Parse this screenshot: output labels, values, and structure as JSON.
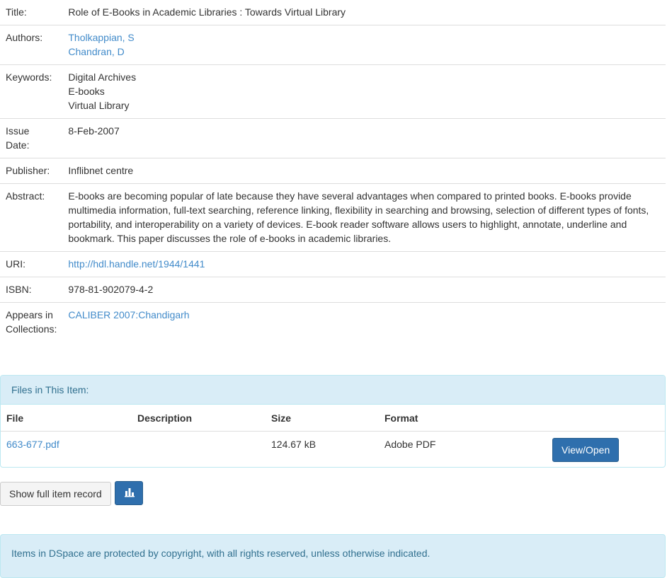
{
  "metadata": {
    "title_label": "Title:",
    "title": "Role of E-Books in Academic Libraries : Towards Virtual Library",
    "authors_label": "Authors:",
    "authors": [
      "Tholkappian, S",
      "Chandran, D"
    ],
    "keywords_label": "Keywords:",
    "keywords": [
      "Digital Archives",
      "E-books",
      "Virtual Library"
    ],
    "issue_date_label_1": "Issue",
    "issue_date_label_2": "Date:",
    "issue_date": "8-Feb-2007",
    "publisher_label": "Publisher:",
    "publisher": "Inflibnet centre",
    "abstract_label": "Abstract:",
    "abstract": "E-books are becoming popular of late because they have several advantages when compared to printed books. E-books provide multimedia information, full-text searching, reference linking, flexibility in searching and browsing, selection of different types of fonts, portability, and interoperability on a variety of devices. E-book reader software allows users to highlight, annotate, underline and bookmark. This paper discusses the role of e-books in academic libraries.",
    "uri_label": "URI:",
    "uri": "http://hdl.handle.net/1944/1441",
    "isbn_label": "ISBN:",
    "isbn": "978-81-902079-4-2",
    "collections_label_1": "Appears in",
    "collections_label_2": "Collections:",
    "collection": "CALIBER 2007:Chandigarh"
  },
  "files": {
    "heading": "Files in This Item:",
    "columns": [
      "File",
      "Description",
      "Size",
      "Format"
    ],
    "rows": [
      {
        "file": "663-677.pdf",
        "description": "",
        "size": "124.67 kB",
        "format": "Adobe PDF",
        "action": "View/Open"
      }
    ]
  },
  "actions": {
    "show_full_record": "Show full item record",
    "stats_icon": "bar-chart-icon"
  },
  "footer": {
    "notice": "Items in DSpace are protected by copyright, with all rights reserved, unless otherwise indicated."
  },
  "colors": {
    "link": "#428bca",
    "panel_bg": "#d9edf7",
    "panel_text": "#31708f",
    "primary_button": "#2f6fad"
  }
}
